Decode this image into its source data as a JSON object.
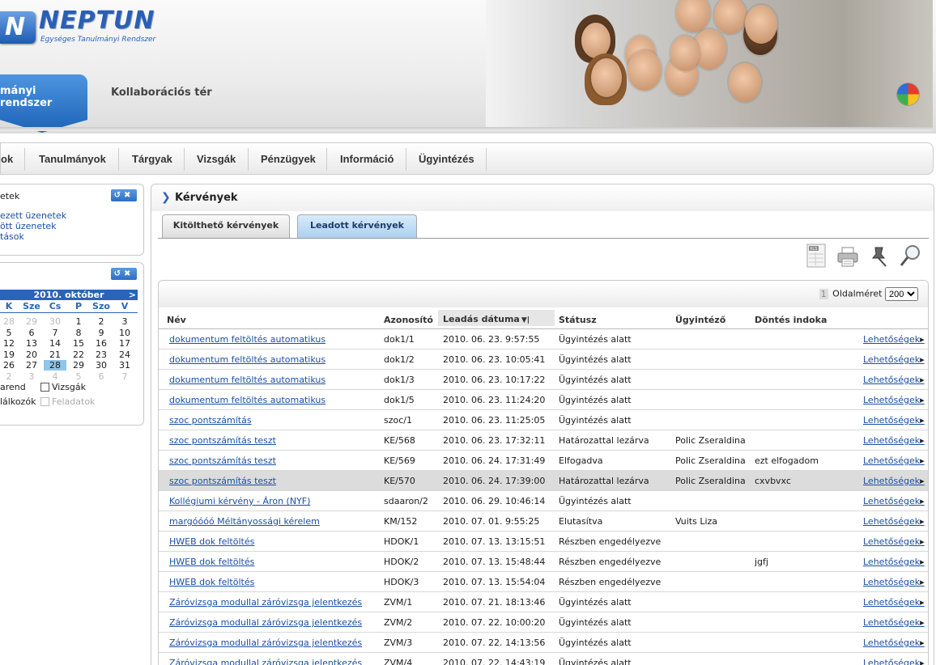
{
  "header": {
    "logo_letter": "N",
    "logo_name": "NEPTUN",
    "logo_subtitle": "Egységes Tanulmányi Rendszer",
    "tab_active": "mányi rendszer",
    "tab_collab": "Kollaborációs tér"
  },
  "menu": {
    "items": [
      "ok",
      "Tanulmányok",
      "Tárgyak",
      "Vizsgák",
      "Pénzügyek",
      "Információ",
      "Ügyintézés"
    ]
  },
  "messages": {
    "title": "etek",
    "buttons": "↺✖",
    "links": [
      "ezett üzenetek",
      "ött üzenetek",
      "tások"
    ]
  },
  "calendar": {
    "buttons": "↺✖",
    "month": "2010. október",
    "next": ">",
    "days": [
      "K",
      "Sze",
      "Cs",
      "P",
      "Szo",
      "V"
    ],
    "weeks": [
      [
        "28",
        "29",
        "30",
        "1",
        "2",
        "3"
      ],
      [
        "5",
        "6",
        "7",
        "8",
        "9",
        "10"
      ],
      [
        "12",
        "13",
        "14",
        "15",
        "16",
        "17"
      ],
      [
        "19",
        "20",
        "21",
        "22",
        "23",
        "24"
      ],
      [
        "26",
        "27",
        "28",
        "29",
        "30",
        "31"
      ],
      [
        "2",
        "3",
        "4",
        "5",
        "6",
        "7"
      ]
    ],
    "legend1a": "arend",
    "legend1b": "Vizsgák",
    "legend2a": "lálkozók",
    "legend2b": "Feladatok"
  },
  "content": {
    "title": "Kérvények",
    "tab_fill": "Kitölthető kérvények",
    "tab_submitted": "Leadott kérvények",
    "pager_page": "1",
    "pager_label": "Oldalméret",
    "page_size": "200",
    "columns": [
      "Név",
      "Azonosító",
      "Leadás dátuma",
      "Státusz",
      "Ügyintéző",
      "Döntés indoka"
    ],
    "more_label": "Lehetőségek",
    "rows": [
      {
        "name": "dokumentum feltöltés automatikus",
        "id": "dok1/1",
        "date": "2010. 06. 23. 9:57:55",
        "status": "Ügyintézés alatt",
        "agent": "",
        "reason": ""
      },
      {
        "name": "dokumentum feltöltés automatikus",
        "id": "dok1/2",
        "date": "2010. 06. 23. 10:05:41",
        "status": "Ügyintézés alatt",
        "agent": "",
        "reason": ""
      },
      {
        "name": "dokumentum feltöltés automatikus",
        "id": "dok1/3",
        "date": "2010. 06. 23. 10:17:22",
        "status": "Ügyintézés alatt",
        "agent": "",
        "reason": ""
      },
      {
        "name": "dokumentum feltöltés automatikus",
        "id": "dok1/5",
        "date": "2010. 06. 23. 11:24:20",
        "status": "Ügyintézés alatt",
        "agent": "",
        "reason": ""
      },
      {
        "name": "szoc pontszámítás",
        "id": "szoc/1",
        "date": "2010. 06. 23. 11:25:05",
        "status": "Ügyintézés alatt",
        "agent": "",
        "reason": ""
      },
      {
        "name": "szoc pontszámítás teszt",
        "id": "KE/568",
        "date": "2010. 06. 23. 17:32:11",
        "status": "Határozattal lezárva",
        "agent": "Polic Zseraldina",
        "reason": ""
      },
      {
        "name": "szoc pontszámítás teszt",
        "id": "KE/569",
        "date": "2010. 06. 24. 17:31:49",
        "status": "Elfogadva",
        "agent": "Polic Zseraldina",
        "reason": "ezt elfogadom"
      },
      {
        "name": "szoc pontszámítás teszt",
        "id": "KE/570",
        "date": "2010. 06. 24. 17:39:00",
        "status": "Határozattal lezárva",
        "agent": "Polic Zseraldina",
        "reason": "cxvbvxc"
      },
      {
        "name": "Kollégiumi kérvény - Áron (NYF)",
        "id": "sdaaron/2",
        "date": "2010. 06. 29. 10:46:14",
        "status": "Ügyintézés alatt",
        "agent": "",
        "reason": ""
      },
      {
        "name": "margóóóó Méltányossági kérelem",
        "id": "KM/152",
        "date": "2010. 07. 01. 9:55:25",
        "status": "Elutasítva",
        "agent": "Vuits Liza",
        "reason": ""
      },
      {
        "name": "HWEB dok feltöltés",
        "id": "HDOK/1",
        "date": "2010. 07. 13. 13:15:51",
        "status": "Részben engedélyezve",
        "agent": "",
        "reason": ""
      },
      {
        "name": "HWEB dok feltöltés",
        "id": "HDOK/2",
        "date": "2010. 07. 13. 15:48:44",
        "status": "Részben engedélyezve",
        "agent": "",
        "reason": "jgfj"
      },
      {
        "name": "HWEB dok feltöltés",
        "id": "HDOK/3",
        "date": "2010. 07. 13. 15:54:04",
        "status": "Részben engedélyezve",
        "agent": "",
        "reason": ""
      },
      {
        "name": "Záróvizsga modullal záróvizsga jelentkezés",
        "id": "ZVM/1",
        "date": "2010. 07. 21. 18:13:46",
        "status": "Ügyintézés alatt",
        "agent": "",
        "reason": ""
      },
      {
        "name": "Záróvizsga modullal záróvizsga jelentkezés",
        "id": "ZVM/2",
        "date": "2010. 07. 22. 10:00:20",
        "status": "Ügyintézés alatt",
        "agent": "",
        "reason": ""
      },
      {
        "name": "Záróvizsga modullal záróvizsga jelentkezés",
        "id": "ZVM/3",
        "date": "2010. 07. 22. 14:13:56",
        "status": "Ügyintézés alatt",
        "agent": "",
        "reason": ""
      },
      {
        "name": "Záróvizsga modullal záróvizsga jelentkezés",
        "id": "ZVM/4",
        "date": "2010. 07. 22. 14:43:19",
        "status": "Ügyintézés alatt",
        "agent": "",
        "reason": ""
      }
    ]
  }
}
